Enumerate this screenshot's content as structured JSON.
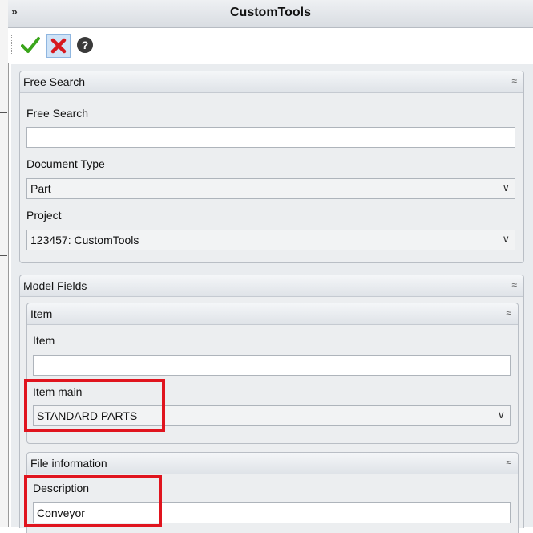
{
  "window": {
    "title": "CustomTools",
    "collapse_glyph": "»"
  },
  "toolbar": {
    "ok_icon": "checkmark-icon",
    "cancel_icon": "close-icon",
    "help_icon": "help-icon",
    "help_glyph": "?"
  },
  "free_search_group": {
    "title": "Free Search",
    "free_search_label": "Free Search",
    "free_search_value": "",
    "document_type_label": "Document Type",
    "document_type_value": "Part",
    "project_label": "Project",
    "project_value": "123457: CustomTools"
  },
  "model_fields_group": {
    "title": "Model Fields",
    "item_group": {
      "title": "Item",
      "item_label": "Item",
      "item_value": "",
      "item_main_label": "Item main",
      "item_main_value": "STANDARD PARTS"
    },
    "file_info_group": {
      "title": "File information",
      "description_label": "Description",
      "description_value": "Conveyor"
    }
  },
  "glyphs": {
    "collapse_up": "≈",
    "dropdown": "∨"
  },
  "colors": {
    "highlight": "#e0141e",
    "ok_green": "#3aa51b",
    "cancel_red": "#d7191f"
  }
}
